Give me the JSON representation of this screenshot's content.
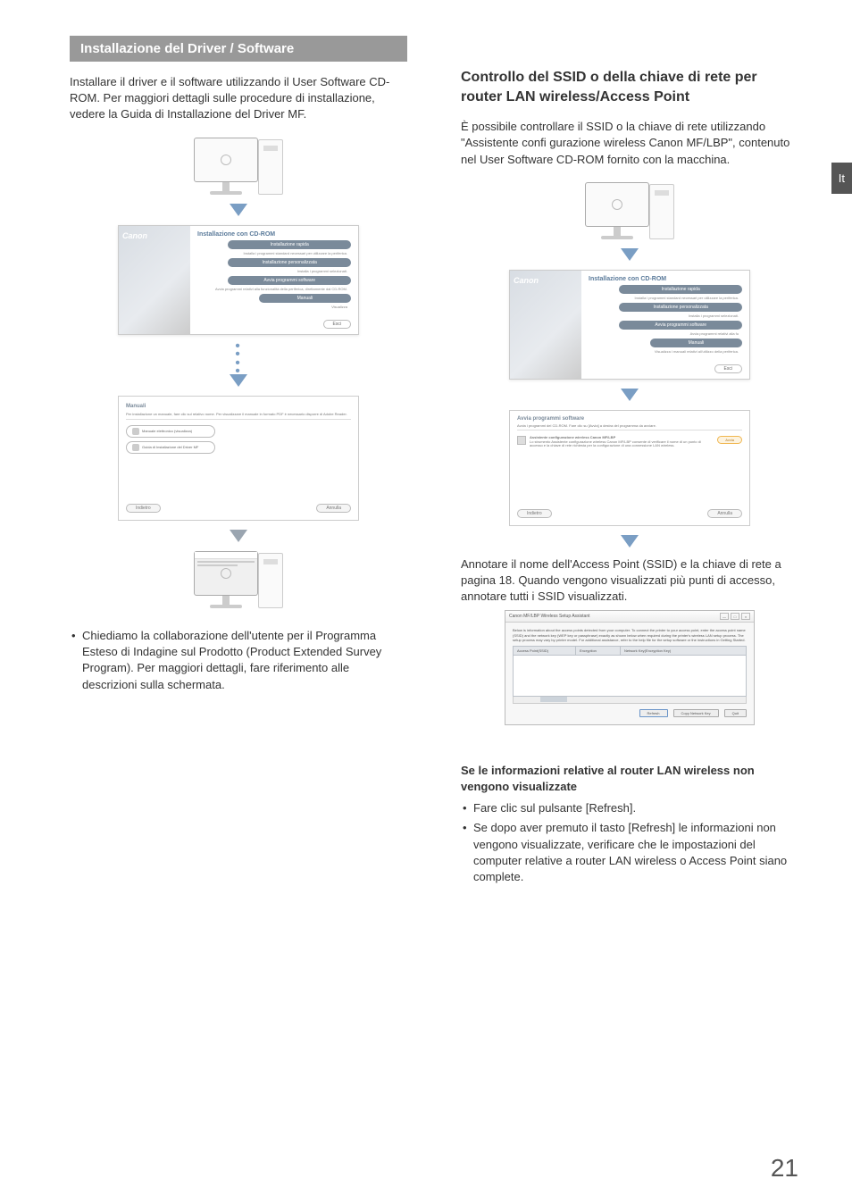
{
  "sideTab": "It",
  "pageNumber": "21",
  "left": {
    "sectionTitle": "Installazione del Driver / Software",
    "intro": "Installare il driver e il software utilizzando il User Software CD-ROM. Per maggiori dettagli sulle procedure di installazione, vedere la Guida di Installazione del Driver MF.",
    "cdDialog": {
      "brand": "Canon",
      "title": "Installazione con CD-ROM",
      "btn1": "Installazione rapida",
      "sub1": "Installa i programmi standard necessari per utilizzare la periferica.",
      "btn2": "Installazione personalizzata",
      "sub2": "Installa i programmi selezionati.",
      "btn3": "Avvia programmi software",
      "sub3": "Avvia programmi relativi alla funzionalità della periferica, direttamente dal CD-ROM.",
      "btn4": "Manuali",
      "sub4": "Visualizza",
      "exit": "Esci"
    },
    "manualsDialog": {
      "title": "Manuali",
      "sub": "Per installazione un manuale, fare clic sul relativo nome. Per visualizzare il manuale in formato PDF è necessario disporre di Adobe Reader.",
      "item1": "Manuale elettronico (visualizza)",
      "item2": "Guida di Installazione del Driver MF",
      "back": "Indietro",
      "cancel": "Annulla"
    },
    "bullet": "Chiediamo la collaborazione dell'utente per il Programma Esteso di Indagine sul Prodotto (Product Extended Survey Program). Per maggiori dettagli, fare riferimento alle descrizioni sulla schermata."
  },
  "right": {
    "heading": "Controllo del SSID o della chiave di rete per router LAN wireless/Access Point",
    "intro": "È possibile controllare il SSID o la chiave di rete utilizzando \"Assistente confi gurazione wireless Canon MF/LBP\", contenuto nel User Software CD-ROM fornito con la macchina.",
    "cdDialog": {
      "brand": "Canon",
      "title": "Installazione con CD-ROM",
      "btn1": "Installazione rapida",
      "sub1": "Installa i programmi standard necessari per utilizzare la periferica.",
      "btn2": "Installazione personalizzata",
      "sub2": "Installa i programmi selezionati.",
      "btn3": "Avvia programmi software",
      "sub3": "Avvia programmi relativi alla fu",
      "btn4": "Manuali",
      "sub4": "Visualizza i manuali relativi all'utilizzo della periferica.",
      "exit": "Esci"
    },
    "swDialog": {
      "title": "Avvia programmi software",
      "sub": "Avvia i programmi del CD-ROM. Fare clic su [Avvia] a destra del programma da avviare.",
      "itemTitle": "Assistente configurazione wireless Canon MF/LBP",
      "itemDesc": "Lo strumento Assistente configurazione wireless Canon MF/LBP consente di verificare il nome di un punto di accesso e la chiave di rete richiesta per la configurazione di una connessione LAN wireless.",
      "avvia": "Avvia",
      "back": "Indietro",
      "cancel": "Annulla"
    },
    "annotate": "Annotare il nome dell'Access Point (SSID) e la chiave di rete a pagina 18. Quando vengono visualizzati più punti di accesso, annotare tutti i SSID visualizzati.",
    "wlanDialog": {
      "caption": "Canon MF/LBP Wireless Setup Assistant",
      "desc": "Below is information about the access points detected from your computer. To connect the printer to your access point, enter the access point name (SSID) and the network key (WEP key or passphrase) exactly as shown below when required during the printer's wireless LAN setup process. The setup process may vary by printer model. For additional assistance, refer to the help file for the setup software or the instructions in Getting Started.",
      "colSSID": "Access Point(SSID)",
      "colEnc": "Encryption",
      "colKey": "Network Key(Encryption Key)",
      "refresh": "Refresh",
      "copy": "Copy Network Key",
      "quit": "Quit"
    },
    "troubleshootTitle": "Se le informazioni relative al router LAN wireless non vengono visualizzate",
    "tb1": "Fare clic sul pulsante [Refresh].",
    "tb2": "Se dopo aver premuto il tasto [Refresh] le informazioni non vengono visualizzate, verificare che le impostazioni del computer relative a router LAN wireless o Access Point siano complete."
  }
}
